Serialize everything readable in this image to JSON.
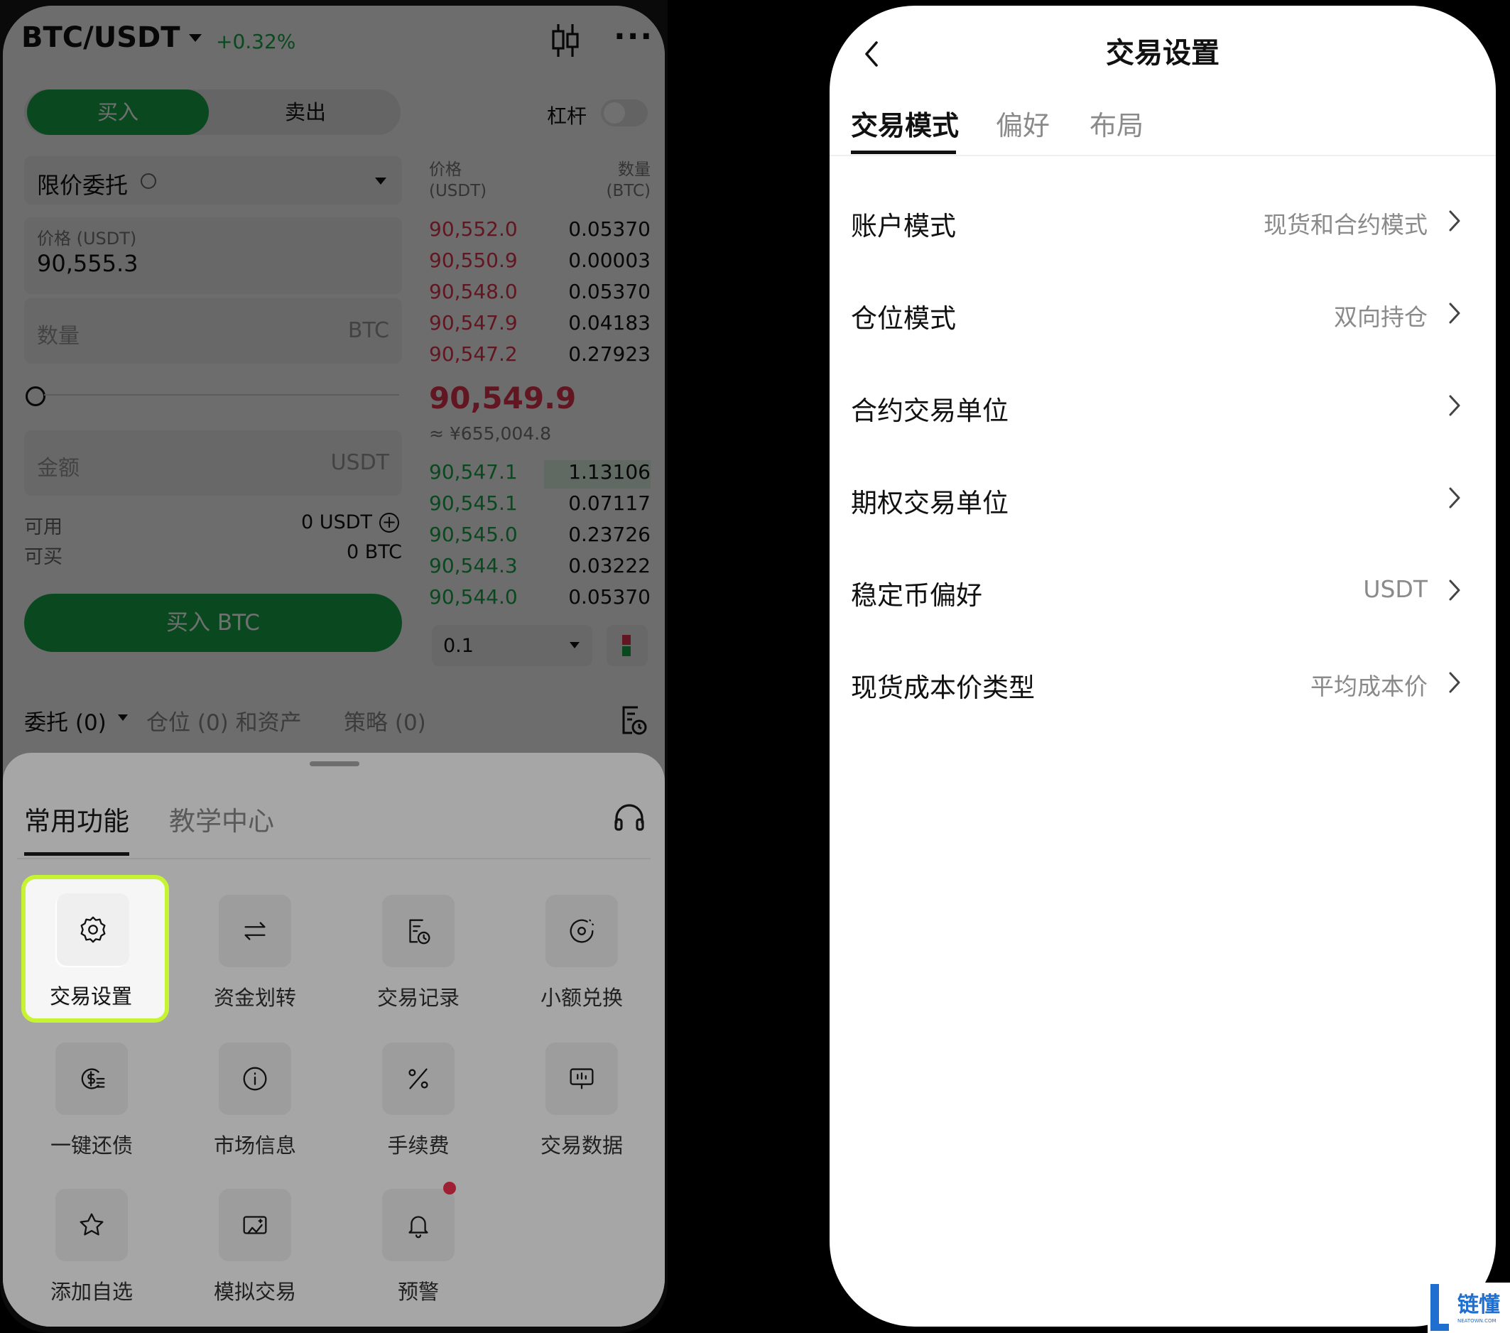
{
  "trade": {
    "pair": "BTC/USDT",
    "change": "+0.32%",
    "buy_tab": "买入",
    "sell_tab": "卖出",
    "leverage_label": "杠杆",
    "order_type": "限价委托",
    "price_col": "价格",
    "price_unit": "(USDT)",
    "qty_col": "数量",
    "qty_unit": "(BTC)",
    "price_input_label": "价格 (USDT)",
    "price_input_value": "90,555.3",
    "qty_placeholder": "数量",
    "qty_unit_suffix": "BTC",
    "amount_placeholder": "金额",
    "amount_unit_suffix": "USDT",
    "available_label": "可用",
    "available_value": "0 USDT",
    "buyable_label": "可买",
    "buyable_value": "0 BTC",
    "buy_button": "买入 BTC",
    "asks": [
      {
        "price": "90,552.0",
        "qty": "0.05370"
      },
      {
        "price": "90,550.9",
        "qty": "0.00003"
      },
      {
        "price": "90,548.0",
        "qty": "0.05370"
      },
      {
        "price": "90,547.9",
        "qty": "0.04183"
      },
      {
        "price": "90,547.2",
        "qty": "0.27923"
      }
    ],
    "last_price": "90,549.9",
    "last_price_cny": "≈ ¥655,004.8",
    "bids": [
      {
        "price": "90,547.1",
        "qty": "1.13106"
      },
      {
        "price": "90,545.1",
        "qty": "0.07117"
      },
      {
        "price": "90,545.0",
        "qty": "0.23726"
      },
      {
        "price": "90,544.3",
        "qty": "0.03222"
      },
      {
        "price": "90,544.0",
        "qty": "0.05370"
      }
    ],
    "depth_step": "0.1",
    "orders_tab": "委托 (0)",
    "positions_tab": "仓位 (0) 和资产",
    "strategy_tab": "策略 (0)"
  },
  "sheet": {
    "tab_common": "常用功能",
    "tab_learn": "教学中心",
    "items": [
      {
        "label": "交易设置",
        "icon": "gear-icon"
      },
      {
        "label": "资金划转",
        "icon": "transfer-icon"
      },
      {
        "label": "交易记录",
        "icon": "records-icon"
      },
      {
        "label": "小额兑换",
        "icon": "small-convert-icon"
      },
      {
        "label": "一键还债",
        "icon": "repay-icon"
      },
      {
        "label": "市场信息",
        "icon": "info-icon"
      },
      {
        "label": "手续费",
        "icon": "percent-icon"
      },
      {
        "label": "交易数据",
        "icon": "data-icon"
      },
      {
        "label": "添加自选",
        "icon": "star-icon"
      },
      {
        "label": "模拟交易",
        "icon": "demo-trade-icon"
      },
      {
        "label": "预警",
        "icon": "bell-icon"
      }
    ]
  },
  "settings": {
    "title": "交易设置",
    "tabs": [
      "交易模式",
      "偏好",
      "布局"
    ],
    "rows": [
      {
        "label": "账户模式",
        "value": "现货和合约模式"
      },
      {
        "label": "仓位模式",
        "value": "双向持仓"
      },
      {
        "label": "合约交易单位",
        "value": ""
      },
      {
        "label": "期权交易单位",
        "value": ""
      },
      {
        "label": "稳定币偏好",
        "value": "USDT"
      },
      {
        "label": "现货成本价类型",
        "value": "平均成本价"
      }
    ]
  },
  "watermark": {
    "text": "链懂",
    "sub": "NEATOWN.COM"
  },
  "colors": {
    "buy_green": "#17a64a",
    "sell_red": "#e0334c",
    "highlight": "#c6f432"
  }
}
